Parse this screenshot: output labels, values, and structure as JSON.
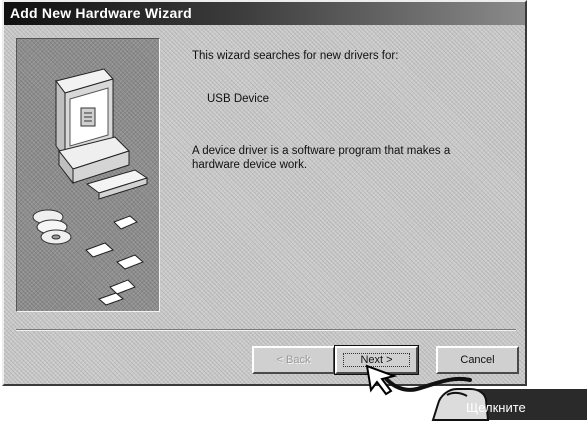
{
  "window": {
    "title": "Add New Hardware Wizard"
  },
  "content": {
    "intro": "This wizard searches for new drivers for:",
    "device_name": "USB Device",
    "description": "A device driver is a software program that makes a hardware device work."
  },
  "buttons": {
    "back": "< Back",
    "next": "Next >",
    "cancel": "Cancel"
  },
  "annotation": {
    "label": "Щелкните"
  },
  "icons": {
    "hardware_illustration": "computer-and-discs-icon",
    "mouse_cursor": "arrow-cursor-icon",
    "click_hand": "click-hand-icon"
  },
  "colors": {
    "title_bar": "#101010",
    "dialog_background": "#c9c9c9",
    "callout_fill": "#2a2a2a"
  }
}
